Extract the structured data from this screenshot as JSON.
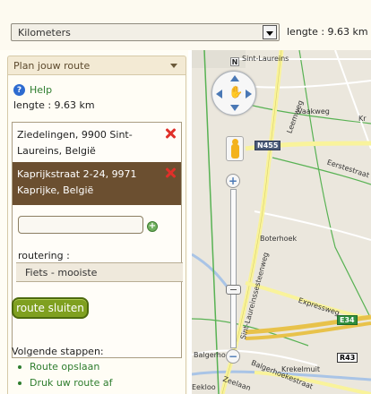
{
  "toolbar": {
    "unit_selected": "Kilometers",
    "length_text": "lengte : 9.63 km"
  },
  "panel": {
    "title": "Plan jouw route",
    "help_label": "Help",
    "length_text": "lengte : 9.63 km",
    "waypoints": [
      {
        "address": "Ziedelingen, 9900 Sint-Laureins, België",
        "selected": false
      },
      {
        "address": "Kaprijkstraat 2-24, 9971 Kaprijke, België",
        "selected": true
      }
    ],
    "new_waypoint_value": "",
    "routering_label": "routering :",
    "routering_value": "Fiets - mooiste",
    "close_button": "route sluiten",
    "next_steps_label": "Volgende stappen:",
    "steps": [
      "Route opslaan",
      "Druk uw route af"
    ]
  },
  "map": {
    "compass_north": "N",
    "zoom_in": "+",
    "zoom_out": "−",
    "zoom_level_fraction": 0.36,
    "labels": {
      "sint_laureins": "Sint-Laureins",
      "vaakweg": "Vaakweg",
      "leemweg": "Leemweg",
      "eerstestraat": "Eerstestraat",
      "kr": "Kr",
      "boterhoek": "Boterhoek",
      "sint_laureinssesteenweg": "Sint-Laureinssesteenweg",
      "expressweg": "Expressweg",
      "balgerhoeke": "Balgerhoeke",
      "balgerhoekestraat": "Balgerhoekestraat",
      "krekelmuit": "Krekelmuit",
      "zeelaan": "Zeelaan",
      "eekloo": "Eekloo"
    },
    "shields": {
      "n455": "N455",
      "e34": "E34",
      "r43": "R43"
    },
    "colors": {
      "water": "#a9c4e6",
      "motorway": "#e8c24a",
      "main_road": "#f9f39b",
      "route_green": "#58b253"
    }
  }
}
